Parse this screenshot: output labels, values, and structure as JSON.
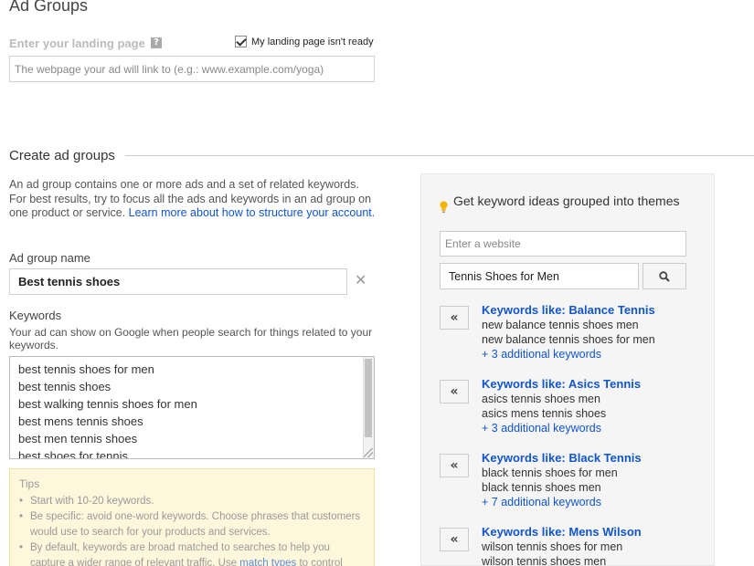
{
  "page_title": "Ad Groups",
  "landing": {
    "label": "Enter your landing page",
    "help_glyph": "?",
    "not_ready_label": "My landing page isn't ready",
    "not_ready_checked": true,
    "placeholder": "The webpage your ad will link to (e.g.: www.example.com/yoga)"
  },
  "create": {
    "section_title": "Create ad groups",
    "intro_text": "An ad group contains one or more ads and a set of related keywords. For best results, try to focus all the ads and keywords in an ad group on one product or service.",
    "learn_more": "Learn more about how to structure your account",
    "ad_group_name_label": "Ad group name",
    "ad_group_name_value": "Best tennis shoes",
    "clear_glyph": "✕",
    "keywords_label": "Keywords",
    "keywords_help": "Your ad can show on Google when people search for things related to your keywords.",
    "keywords": [
      "best tennis shoes for men",
      "best tennis shoes",
      "best walking tennis shoes for men",
      "best mens tennis shoes",
      "best men tennis shoes",
      "best shoes for tennis"
    ]
  },
  "tips": {
    "title": "Tips",
    "items": [
      "Start with 10-20 keywords.",
      "Be specific: avoid one-word keywords. Choose phrases that customers would use to search for your products and services.",
      "By default, keywords are broad matched to searches to help you capture a wider range of relevant traffic. Use"
    ],
    "match_types_link": "match types",
    "after_link": "to control"
  },
  "ideas": {
    "title": "Get keyword ideas grouped into themes",
    "website_placeholder": "Enter a website",
    "theme_value": "Tennis Shoes for Men",
    "add_glyph": "«",
    "groups": [
      {
        "title": "Keywords like: Balance Tennis",
        "kw1": "new balance tennis shoes men",
        "kw2": "new balance tennis shoes for men",
        "more": "+ 3 additional keywords"
      },
      {
        "title": "Keywords like: Asics Tennis",
        "kw1": "asics tennis shoes men",
        "kw2": "asics mens tennis shoes",
        "more": "+ 3 additional keywords"
      },
      {
        "title": "Keywords like: Black Tennis",
        "kw1": "black tennis shoes for men",
        "kw2": "black tennis shoes men",
        "more": "+ 7 additional keywords"
      },
      {
        "title": "Keywords like: Mens Wilson",
        "kw1": "wilson tennis shoes for men",
        "kw2": "wilson tennis shoes men",
        "more": ""
      }
    ]
  },
  "colors": {
    "link": "#1155cc",
    "tips_bg": "#fff7dc",
    "panel_bg": "#f5f5f5",
    "bulb": "#f4b400"
  }
}
